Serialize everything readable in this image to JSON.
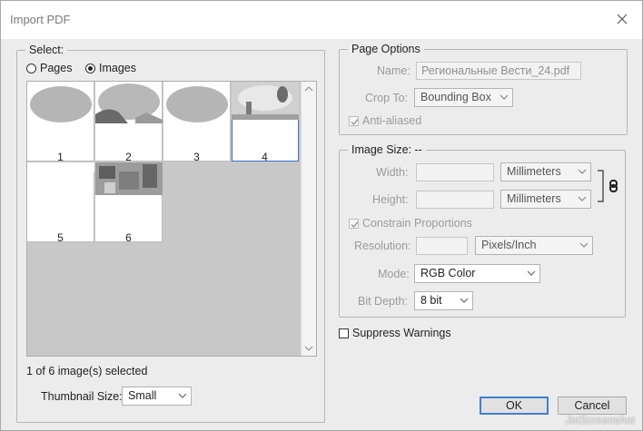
{
  "window": {
    "title": "Import PDF"
  },
  "select_group": {
    "legend": "Select:",
    "pages_label": "Pages",
    "images_label": "Images",
    "selected_mode": "Images",
    "thumbnails": [
      {
        "number": "1",
        "selected": false
      },
      {
        "number": "2",
        "selected": false
      },
      {
        "number": "3",
        "selected": false
      },
      {
        "number": "4",
        "selected": true
      },
      {
        "number": "5",
        "selected": false
      },
      {
        "number": "6",
        "selected": false
      }
    ],
    "status": "1 of 6 image(s) selected",
    "thumbnail_size_label": "Thumbnail Size:",
    "thumbnail_size_value": "Small"
  },
  "page_options": {
    "legend": "Page Options",
    "name_label": "Name:",
    "name_value": "Региональные Вести_24.pdf",
    "crop_label": "Crop To:",
    "crop_value": "Bounding Box",
    "anti_aliased_label": "Anti-aliased",
    "anti_aliased_checked": true
  },
  "image_size": {
    "legend": "Image Size: --",
    "width_label": "Width:",
    "width_unit": "Millimeters",
    "height_label": "Height:",
    "height_unit": "Millimeters",
    "constrain_label": "Constrain Proportions",
    "constrain_checked": true,
    "resolution_label": "Resolution:",
    "resolution_unit": "Pixels/Inch",
    "mode_label": "Mode:",
    "mode_value": "RGB Color",
    "bit_depth_label": "Bit Depth:",
    "bit_depth_value": "8 bit"
  },
  "suppress_warnings_label": "Suppress Warnings",
  "buttons": {
    "ok": "OK",
    "cancel": "Cancel"
  },
  "watermark": "JetScreenshot"
}
